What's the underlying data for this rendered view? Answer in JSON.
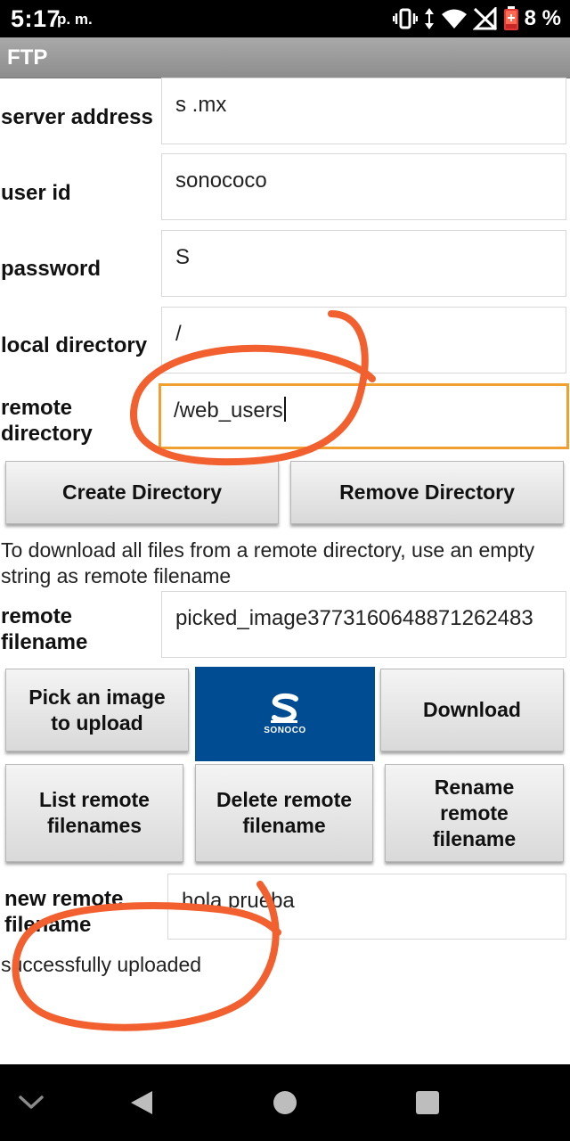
{
  "status_bar": {
    "time": "5:17",
    "ampm": "p. m.",
    "battery": "8 %"
  },
  "app": {
    "title": "FTP"
  },
  "fields": {
    "server_address": {
      "label": "server address",
      "value": "s                .mx"
    },
    "user_id": {
      "label": "user id",
      "value": "sonococo"
    },
    "password": {
      "label": "password",
      "value": "S"
    },
    "local_directory": {
      "label": "local directory",
      "value": "/"
    },
    "remote_directory": {
      "label_line1": "remote",
      "label_line2": "directory",
      "value": "/web_users"
    },
    "remote_filename": {
      "label_line1": "remote",
      "label_line2": "filename",
      "value": "picked_image3773160648871262483"
    },
    "new_remote_filename": {
      "label_line1": "new remote",
      "label_line2": "filename",
      "value": "hola prueba"
    }
  },
  "buttons": {
    "create_directory": "Create Directory",
    "remove_directory": "Remove Directory",
    "pick_image_line1": "Pick an image",
    "pick_image_line2": "to upload",
    "download": "Download",
    "list_remote_line1": "List remote",
    "list_remote_line2": "filenames",
    "delete_remote_line1": "Delete remote",
    "delete_remote_line2": "filename",
    "rename_remote_line1": "Rename",
    "rename_remote_line2": "remote",
    "rename_remote_line3": "filename"
  },
  "info_text": "To download all files from a remote directory, use an empty string as remote filename",
  "logo": {
    "word": "SONOCO",
    "background": "#004c93"
  },
  "status_message": "successfully uploaded",
  "icons": {
    "statusbar": [
      "vibrate-icon",
      "data-arrows-icon",
      "wifi-icon",
      "no-signal-icon",
      "battery-low-icon"
    ],
    "navbar": [
      "chevron-down-icon",
      "back-icon",
      "home-icon",
      "recents-icon"
    ]
  },
  "colors": {
    "annotation": "#f2602f",
    "focus_border": "#f0a030"
  }
}
